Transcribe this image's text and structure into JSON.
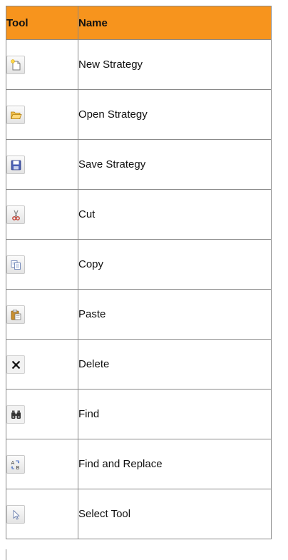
{
  "header": {
    "tool_label": "Tool",
    "name_label": "Name"
  },
  "colors": {
    "header_bg": "#f7941d",
    "border": "#8a8a8a"
  },
  "rows": [
    {
      "icon": "new-strategy-icon",
      "name": "New Strategy"
    },
    {
      "icon": "open-strategy-icon",
      "name": "Open Strategy"
    },
    {
      "icon": "save-strategy-icon",
      "name": "Save Strategy"
    },
    {
      "icon": "cut-icon",
      "name": "Cut"
    },
    {
      "icon": "copy-icon",
      "name": "Copy"
    },
    {
      "icon": "paste-icon",
      "name": "Paste"
    },
    {
      "icon": "delete-icon",
      "name": "Delete"
    },
    {
      "icon": "find-icon",
      "name": "Find"
    },
    {
      "icon": "find-and-replace-icon",
      "name": "Find and Replace"
    },
    {
      "icon": "select-tool-icon",
      "name": "Select Tool"
    }
  ]
}
